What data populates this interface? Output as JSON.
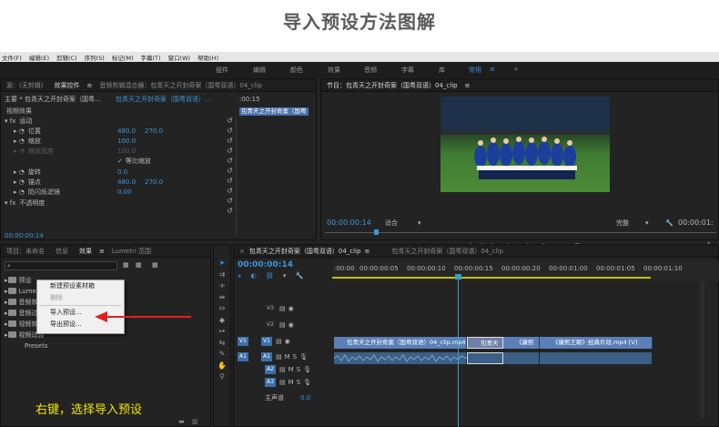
{
  "page_title": "导入预设方法图解",
  "menubar": [
    "文件(F)",
    "编辑(E)",
    "剪辑(C)",
    "序列(S)",
    "标记(M)",
    "字幕(T)",
    "窗口(W)",
    "帮助(H)"
  ],
  "workspaces": [
    "组件",
    "编辑",
    "颜色",
    "效果",
    "音频",
    "字幕",
    "库",
    "常用"
  ],
  "workspace_active_menu": "≡",
  "workspace_more": "»",
  "effect_controls": {
    "tab_source": "源：(无剪辑)",
    "tab_effect": "效果控件",
    "tab_menu": "≡",
    "tab_mixer": "音频剪辑混合器：包青天之开封奇案（国粤双语）04_clip",
    "master_label": "主要 * 包青天之开封奇案（国粤...",
    "sequence_label": "包青天之开封奇案（国粤双语）...",
    "time_start": ":00:15",
    "clip_bar": "包青天之开封奇案（国粤",
    "section_video": "视频效果",
    "motion": "运动",
    "position": "位置",
    "position_x": "480.0",
    "position_y": "270.0",
    "scale": "缩放",
    "scale_value": "100.0",
    "scale_width": "缩放宽度",
    "scale_width_value": "100.0",
    "uniform_scale": "等比缩放",
    "rotation": "旋转",
    "rotation_value": "0.0",
    "anchor": "锚点",
    "anchor_x": "480.0",
    "anchor_y": "270.0",
    "antiflicker": "防闪烁滤镜",
    "antiflicker_value": "0.00",
    "opacity": "不透明度",
    "timecode": "00:00:00:14"
  },
  "program_monitor": {
    "title": "节目：包青天之开封奇案（国粤双语）04_clip",
    "tab_menu": "≡",
    "timecode": "00:00:00:14",
    "fit": "适合",
    "quality": "完整",
    "duration": "00:00:01:"
  },
  "project_panel": {
    "tabs": [
      "项目：未命名",
      "信息",
      "效果",
      "Lumetri 范围"
    ],
    "tab_menu": "≡",
    "search_icon": "⌕",
    "folders": [
      "预设",
      "Lumetri 预设",
      "音频效果",
      "音频过渡",
      "视频效果",
      "视频过渡",
      "Presets"
    ],
    "annotation": "右键，选择导入预设"
  },
  "context_menu": {
    "items": [
      "新建预设素材箱",
      "删除",
      "导入预设...",
      "导出预设..."
    ]
  },
  "timeline": {
    "tab_close": "×",
    "seq_tab": "包青天之开封奇案（国粤双语）04_clip",
    "tab_menu": "≡",
    "seq_tab2": "包青天之开封奇案（国粤双语）04_clip",
    "timecode": "00:00:00:14",
    "ruler": [
      ":00:00",
      "00:00:00:05",
      "00:00:00:10",
      "00:00:00:15",
      "00:00:00:20",
      "00:00:01:00",
      "00:00:01:05",
      "00:00:01:10"
    ],
    "video_tracks": [
      "V3",
      "V2",
      "V1"
    ],
    "audio_tracks": [
      "A1",
      "A2",
      "A3"
    ],
    "source_v": "V1",
    "source_a": "A1",
    "master": "主声道",
    "master_value": "0.0",
    "clips": [
      {
        "label": "包青天之开封奇案（国粤双语）04_clip.mp4 [V]"
      },
      {
        "label": "包青天"
      },
      {
        "label": "《康熙"
      },
      {
        "label": "《康熙王朝》经典片段.mp4 [V]"
      }
    ]
  },
  "colors": {
    "accent_blue": "#3d95d8",
    "playhead": "#3aa0c0",
    "arrow_red": "#e02020",
    "annotation_yellow": "#f2e600"
  },
  "icons": {
    "reset": "↺",
    "play": "▶",
    "step_back": "◀|",
    "step_fwd": "|▶",
    "wrench": "🔧",
    "camera": "📷",
    "plus": "+",
    "mark_in": "{",
    "mark_out": "}"
  }
}
